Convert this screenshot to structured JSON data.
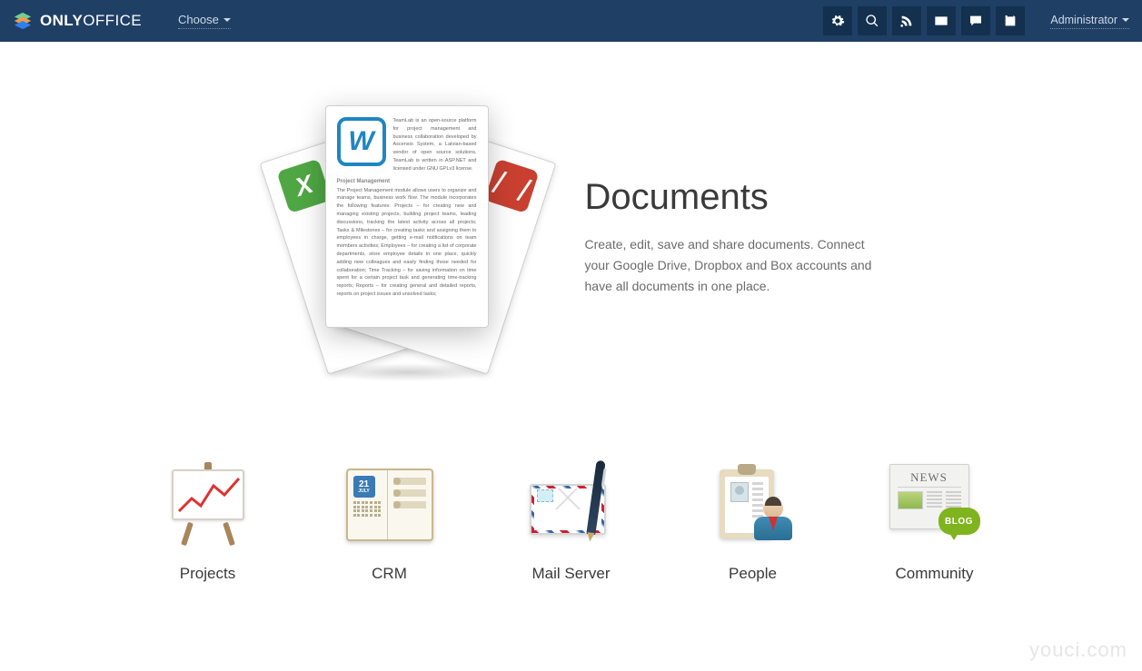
{
  "brand": {
    "name_bold": "ONLY",
    "name_thin": "OFFICE"
  },
  "header": {
    "choose": "Choose",
    "user": "Administrator",
    "icons": [
      "settings",
      "search",
      "feed",
      "mail",
      "chat",
      "calendar"
    ]
  },
  "hero": {
    "title": "Documents",
    "description": "Create, edit, save and share documents. Connect your Google Drive, Dropbox and Box accounts and have all documents in one place.",
    "doc_snippet_1": "TeamLab is an open-source platform for project management and business collaboration developed by Ascensio System, a Latvian-based vendor of open source solutions. TeamLab is written in ASP.NET and licensed under GNU GPLv3 license.",
    "doc_heading": "Project Management",
    "doc_snippet_2": "The Project Management module allows users to organize and manage teams, business work flow. The module incorporates the following features: Projects – for creating new and managing existing projects, building project teams, leading discussions, tracking the latest activity across all projects; Tasks & Milestones – for creating tasks and assigning them to employees in charge, getting e-mail notifications on team members activities; Employees – for creating a list of corporate departments, store employee details in one place, quickly adding new colleagues and easily finding those needed for collaboration; Time Tracking – for saving information on time spent for a certain project task and generating time-tracking reports; Reports – for creating general and detailed reports, reports on project issues and unsolved tasks;"
  },
  "modules": [
    {
      "id": "projects",
      "label": "Projects"
    },
    {
      "id": "crm",
      "label": "CRM"
    },
    {
      "id": "mail",
      "label": "Mail Server"
    },
    {
      "id": "people",
      "label": "People"
    },
    {
      "id": "community",
      "label": "Community"
    }
  ],
  "crm_calendar": {
    "day": "21",
    "month": "JULY"
  },
  "community": {
    "newspaper_title": "NEWS",
    "blog_badge": "BLOG"
  },
  "watermark": "youci.com"
}
